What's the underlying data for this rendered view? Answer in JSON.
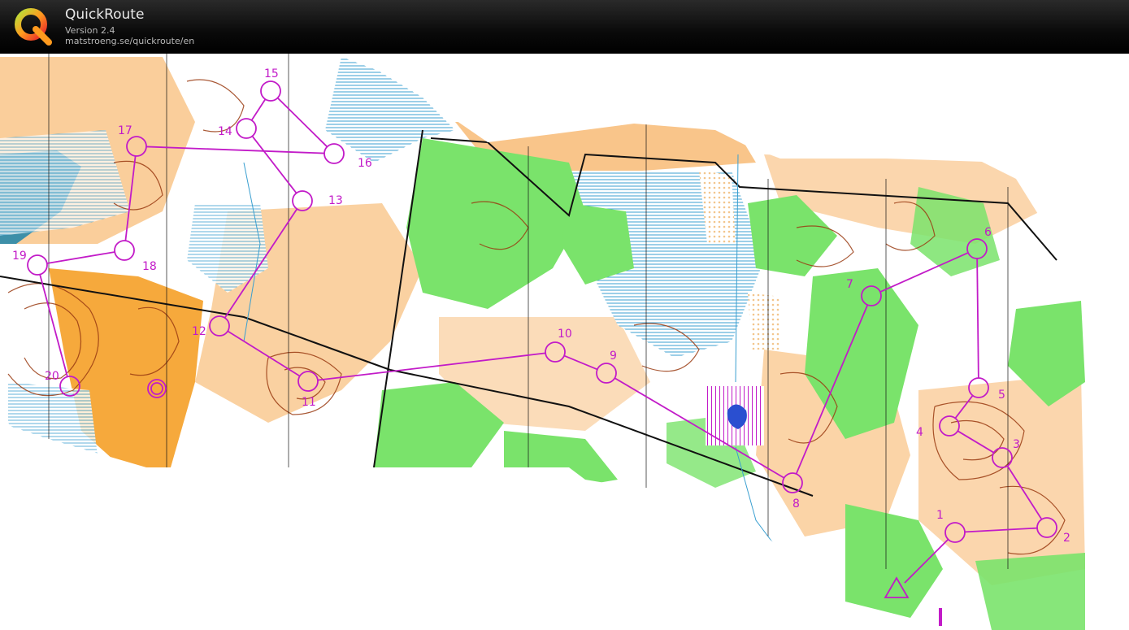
{
  "app": {
    "name": "QuickRoute",
    "version": "Version 2.4",
    "url": "matstroeng.se/quickroute/en"
  },
  "colors": {
    "course": "#c21bc8",
    "open_land": "#f9c58a",
    "rough_open": "#f6a93c",
    "forest_green": "#7ae36b",
    "light_green": "#c3f0b8",
    "marsh": "#6ab0d8",
    "water": "#3d8fa8",
    "contour": "#9a3b12",
    "header": "#000000"
  },
  "icons": {
    "logo": "quickroute-q-logo"
  },
  "course": {
    "start_label": "",
    "controls": [
      {
        "n": "1"
      },
      {
        "n": "2"
      },
      {
        "n": "3"
      },
      {
        "n": "4"
      },
      {
        "n": "5"
      },
      {
        "n": "6"
      },
      {
        "n": "7"
      },
      {
        "n": "8"
      },
      {
        "n": "9"
      },
      {
        "n": "10"
      },
      {
        "n": "11"
      },
      {
        "n": "12"
      },
      {
        "n": "13"
      },
      {
        "n": "14"
      },
      {
        "n": "15"
      },
      {
        "n": "16"
      },
      {
        "n": "17"
      },
      {
        "n": "18"
      },
      {
        "n": "19"
      },
      {
        "n": "20"
      }
    ]
  }
}
